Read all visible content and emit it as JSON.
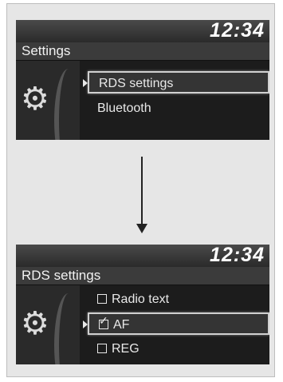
{
  "screen1": {
    "clock": "12:34",
    "title": "Settings",
    "items": [
      {
        "label": "RDS settings",
        "selected": true
      },
      {
        "label": "Bluetooth",
        "selected": false
      }
    ]
  },
  "screen2": {
    "clock": "12:34",
    "title": "RDS settings",
    "items": [
      {
        "label": "Radio text",
        "checked": false,
        "selected": false
      },
      {
        "label": "AF",
        "checked": true,
        "selected": true
      },
      {
        "label": "REG",
        "checked": false,
        "selected": false
      }
    ]
  },
  "icons": {
    "settings": "gear-icon",
    "transition": "arrow-down-icon"
  }
}
